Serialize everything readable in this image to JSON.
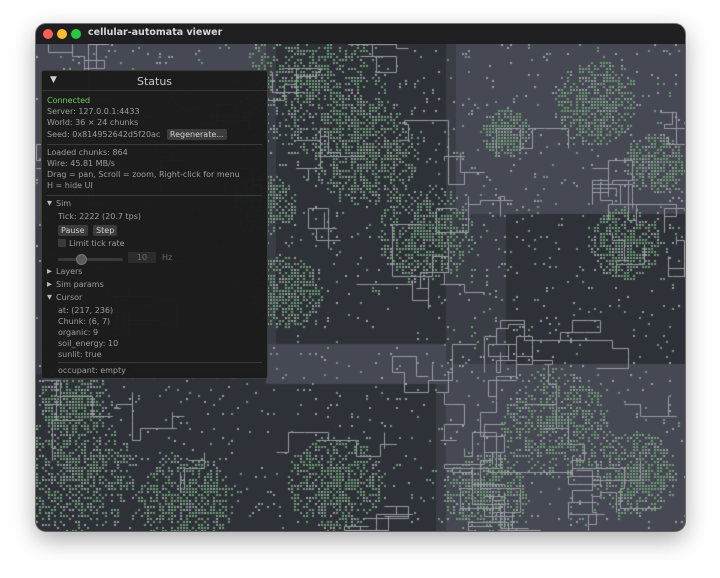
{
  "window": {
    "title": "cellular-automata viewer"
  },
  "status": {
    "header": "Status",
    "connection": "Connected",
    "server": "Server: 127.0.0.1:4433",
    "world": "World: 36 × 24 chunks",
    "seed": "Seed: 0x814952642d5f20ac",
    "regenerate_label": "Regenerate...",
    "loaded_chunks": "Loaded chunks: 864",
    "wire": "Wire: 45.81 MB/s",
    "help_line": "Drag = pan, Scroll = zoom, Right-click for menu",
    "hide_hint": "H = hide UI"
  },
  "sim": {
    "header": "Sim",
    "tick": "Tick: 2222  (20.7 tps)",
    "pause_label": "Pause",
    "step_label": "Step",
    "limit_label": "Limit tick rate",
    "limit_checked": false,
    "rate_value": "10",
    "rate_unit": "Hz"
  },
  "sections": {
    "layers": "Layers",
    "sim_params": "Sim params",
    "cursor": "Cursor"
  },
  "cursor": {
    "at": "at: (217, 236)",
    "chunk": "Chunk: (6, 7)",
    "organic": "organic: 9",
    "soil_energy": "soil_energy: 10",
    "sunlit": "sunlit: true",
    "occupant": "occupant: empty"
  },
  "colors": {
    "background": "#3a3d46",
    "shade_dark": "#2f3139",
    "shade_light": "#464953",
    "organism": "#6c9a73",
    "wall": "#9a9ba3",
    "accent_connected": "#6fce5c"
  }
}
